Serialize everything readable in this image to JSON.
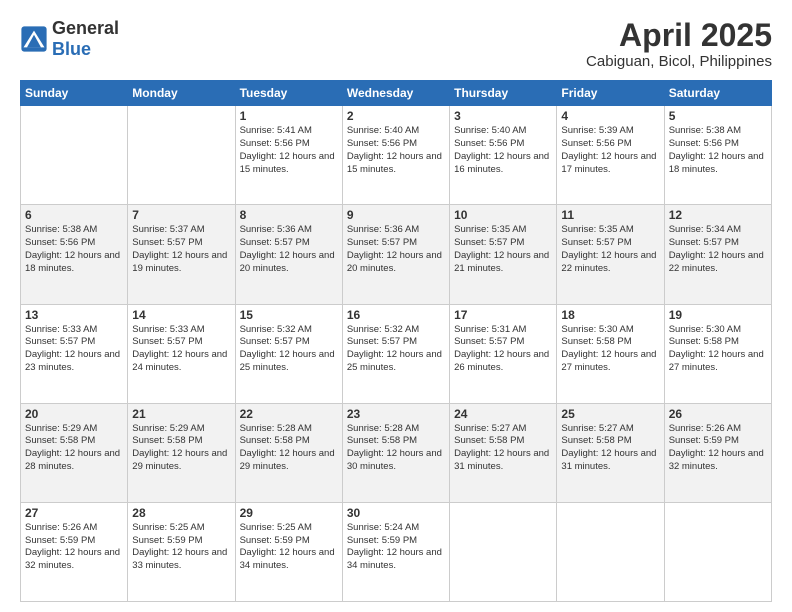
{
  "logo": {
    "general": "General",
    "blue": "Blue"
  },
  "header": {
    "month": "April 2025",
    "location": "Cabiguan, Bicol, Philippines"
  },
  "days_of_week": [
    "Sunday",
    "Monday",
    "Tuesday",
    "Wednesday",
    "Thursday",
    "Friday",
    "Saturday"
  ],
  "weeks": [
    [
      {
        "day": "",
        "info": ""
      },
      {
        "day": "",
        "info": ""
      },
      {
        "day": "1",
        "info": "Sunrise: 5:41 AM\nSunset: 5:56 PM\nDaylight: 12 hours and 15 minutes."
      },
      {
        "day": "2",
        "info": "Sunrise: 5:40 AM\nSunset: 5:56 PM\nDaylight: 12 hours and 15 minutes."
      },
      {
        "day": "3",
        "info": "Sunrise: 5:40 AM\nSunset: 5:56 PM\nDaylight: 12 hours and 16 minutes."
      },
      {
        "day": "4",
        "info": "Sunrise: 5:39 AM\nSunset: 5:56 PM\nDaylight: 12 hours and 17 minutes."
      },
      {
        "day": "5",
        "info": "Sunrise: 5:38 AM\nSunset: 5:56 PM\nDaylight: 12 hours and 18 minutes."
      }
    ],
    [
      {
        "day": "6",
        "info": "Sunrise: 5:38 AM\nSunset: 5:56 PM\nDaylight: 12 hours and 18 minutes."
      },
      {
        "day": "7",
        "info": "Sunrise: 5:37 AM\nSunset: 5:57 PM\nDaylight: 12 hours and 19 minutes."
      },
      {
        "day": "8",
        "info": "Sunrise: 5:36 AM\nSunset: 5:57 PM\nDaylight: 12 hours and 20 minutes."
      },
      {
        "day": "9",
        "info": "Sunrise: 5:36 AM\nSunset: 5:57 PM\nDaylight: 12 hours and 20 minutes."
      },
      {
        "day": "10",
        "info": "Sunrise: 5:35 AM\nSunset: 5:57 PM\nDaylight: 12 hours and 21 minutes."
      },
      {
        "day": "11",
        "info": "Sunrise: 5:35 AM\nSunset: 5:57 PM\nDaylight: 12 hours and 22 minutes."
      },
      {
        "day": "12",
        "info": "Sunrise: 5:34 AM\nSunset: 5:57 PM\nDaylight: 12 hours and 22 minutes."
      }
    ],
    [
      {
        "day": "13",
        "info": "Sunrise: 5:33 AM\nSunset: 5:57 PM\nDaylight: 12 hours and 23 minutes."
      },
      {
        "day": "14",
        "info": "Sunrise: 5:33 AM\nSunset: 5:57 PM\nDaylight: 12 hours and 24 minutes."
      },
      {
        "day": "15",
        "info": "Sunrise: 5:32 AM\nSunset: 5:57 PM\nDaylight: 12 hours and 25 minutes."
      },
      {
        "day": "16",
        "info": "Sunrise: 5:32 AM\nSunset: 5:57 PM\nDaylight: 12 hours and 25 minutes."
      },
      {
        "day": "17",
        "info": "Sunrise: 5:31 AM\nSunset: 5:57 PM\nDaylight: 12 hours and 26 minutes."
      },
      {
        "day": "18",
        "info": "Sunrise: 5:30 AM\nSunset: 5:58 PM\nDaylight: 12 hours and 27 minutes."
      },
      {
        "day": "19",
        "info": "Sunrise: 5:30 AM\nSunset: 5:58 PM\nDaylight: 12 hours and 27 minutes."
      }
    ],
    [
      {
        "day": "20",
        "info": "Sunrise: 5:29 AM\nSunset: 5:58 PM\nDaylight: 12 hours and 28 minutes."
      },
      {
        "day": "21",
        "info": "Sunrise: 5:29 AM\nSunset: 5:58 PM\nDaylight: 12 hours and 29 minutes."
      },
      {
        "day": "22",
        "info": "Sunrise: 5:28 AM\nSunset: 5:58 PM\nDaylight: 12 hours and 29 minutes."
      },
      {
        "day": "23",
        "info": "Sunrise: 5:28 AM\nSunset: 5:58 PM\nDaylight: 12 hours and 30 minutes."
      },
      {
        "day": "24",
        "info": "Sunrise: 5:27 AM\nSunset: 5:58 PM\nDaylight: 12 hours and 31 minutes."
      },
      {
        "day": "25",
        "info": "Sunrise: 5:27 AM\nSunset: 5:58 PM\nDaylight: 12 hours and 31 minutes."
      },
      {
        "day": "26",
        "info": "Sunrise: 5:26 AM\nSunset: 5:59 PM\nDaylight: 12 hours and 32 minutes."
      }
    ],
    [
      {
        "day": "27",
        "info": "Sunrise: 5:26 AM\nSunset: 5:59 PM\nDaylight: 12 hours and 32 minutes."
      },
      {
        "day": "28",
        "info": "Sunrise: 5:25 AM\nSunset: 5:59 PM\nDaylight: 12 hours and 33 minutes."
      },
      {
        "day": "29",
        "info": "Sunrise: 5:25 AM\nSunset: 5:59 PM\nDaylight: 12 hours and 34 minutes."
      },
      {
        "day": "30",
        "info": "Sunrise: 5:24 AM\nSunset: 5:59 PM\nDaylight: 12 hours and 34 minutes."
      },
      {
        "day": "",
        "info": ""
      },
      {
        "day": "",
        "info": ""
      },
      {
        "day": "",
        "info": ""
      }
    ]
  ]
}
